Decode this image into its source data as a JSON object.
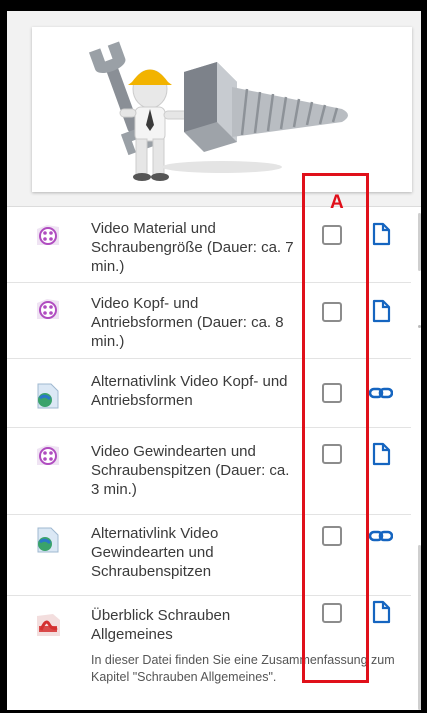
{
  "annotation": {
    "letter": "A",
    "color": "#e0101a"
  },
  "colors": {
    "video_icon": "#b04cc0",
    "link_icon": "#1565c0",
    "file_icon": "#1565c0",
    "pdf_icon": "#d32f2f"
  },
  "items": [
    {
      "label": "Video Material und Schraubengröße (Dauer: ca. 7 min.)",
      "type_icon": "video-file-icon",
      "action_icon": "file-icon",
      "completed": false
    },
    {
      "label": "Video Kopf- und Antriebsformen (Dauer: ca. 8 min.)",
      "type_icon": "video-file-icon",
      "action_icon": "file-icon",
      "completed": false
    },
    {
      "label": "Alternativlink Video Kopf- und Antriebsformen",
      "type_icon": "url-page-icon",
      "action_icon": "link-icon",
      "completed": false
    },
    {
      "label": "Video Gewindearten und Schraubenspitzen (Dauer: ca. 3 min.)",
      "type_icon": "video-file-icon",
      "action_icon": "file-icon",
      "completed": false
    },
    {
      "label": "Alternativlink Video Gewindearten und Schraubenspitzen",
      "type_icon": "url-page-icon",
      "action_icon": "link-icon",
      "completed": false
    },
    {
      "label": "Überblick Schrauben Allgemeines",
      "type_icon": "pdf-file-icon",
      "action_icon": "file-icon",
      "completed": false,
      "description": "In dieser Datei finden Sie eine Zusammenfassung zum Kapitel \"Schrauben Allgemeines\"."
    }
  ]
}
